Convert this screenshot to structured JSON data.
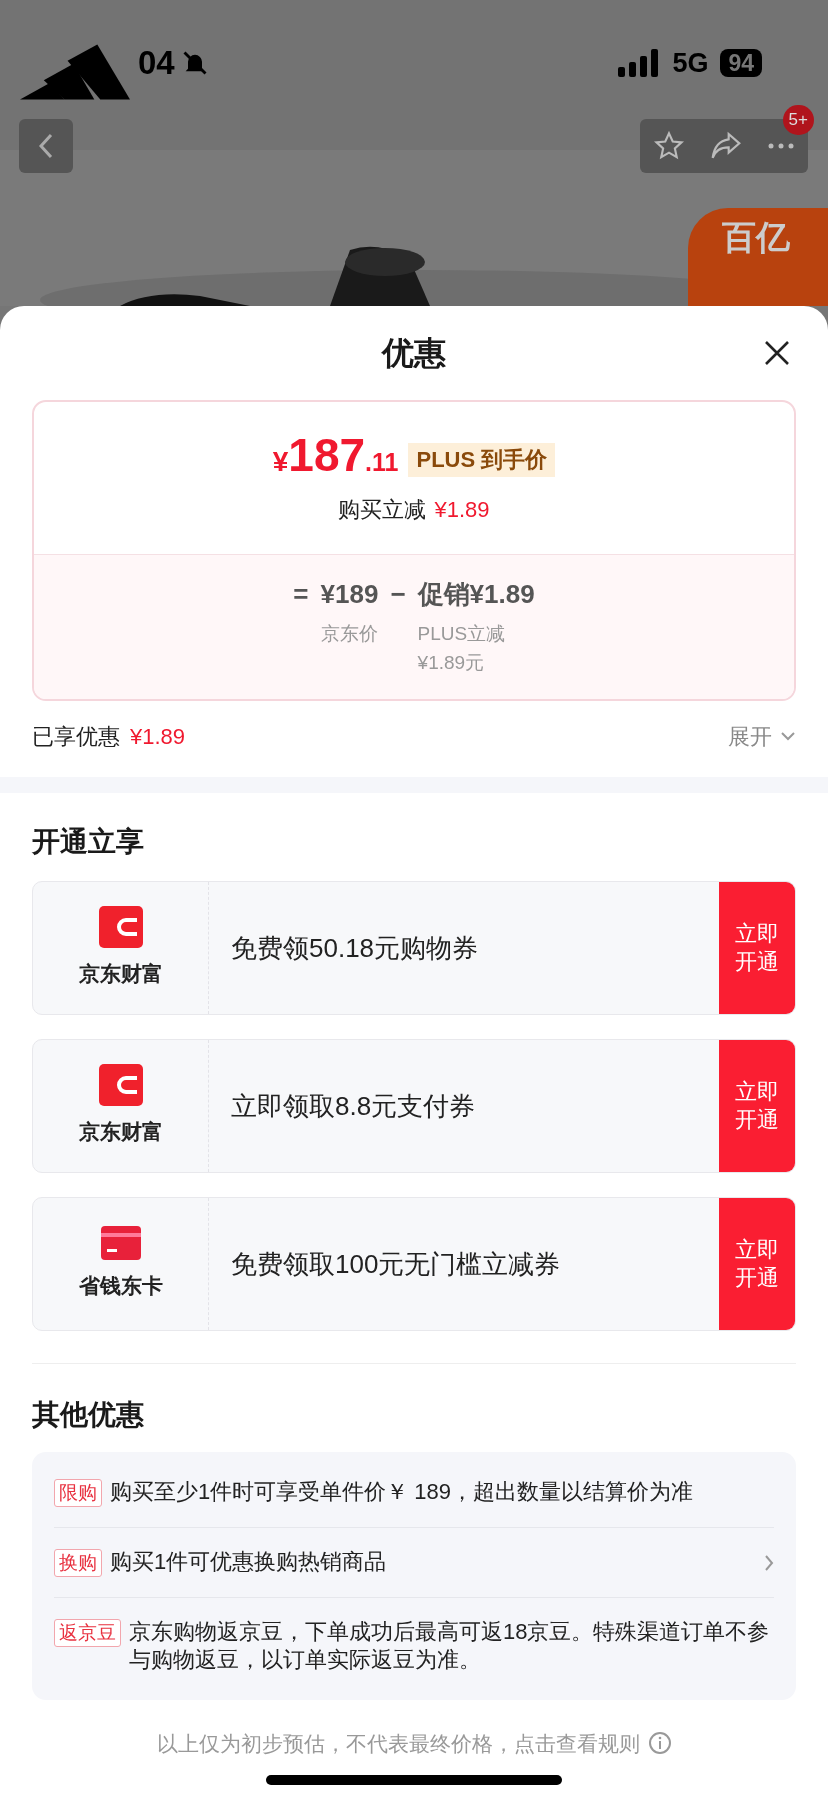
{
  "status_bar": {
    "time": "04",
    "network": "5G",
    "battery": "94"
  },
  "nav": {
    "badge": "5+"
  },
  "promo_badge": {
    "text": "百亿"
  },
  "sheet": {
    "title": "优惠"
  },
  "price_card": {
    "currency": "¥",
    "integer": "187",
    "decimal": ".11",
    "tag": "PLUS 到手价",
    "reduce_label": "购买立减",
    "reduce_amount": "¥1.89",
    "formula": {
      "equals": "=",
      "base": "¥189",
      "base_label": "京东价",
      "minus": "−",
      "promo": "促销¥1.89",
      "promo_label": "PLUS立减",
      "promo_note": "¥1.89元"
    }
  },
  "summary": {
    "label": "已享优惠",
    "amount": "¥1.89",
    "expand": "展开"
  },
  "open_section": {
    "title": "开通立享",
    "offers": [
      {
        "kind": "wallet",
        "brand": "京东财富",
        "text": "免费领50.18元购物券",
        "button": "立即开通"
      },
      {
        "kind": "wallet",
        "brand": "京东财富",
        "text": "立即领取8.8元支付券",
        "button": "立即开通"
      },
      {
        "kind": "card",
        "brand": "省钱东卡",
        "text": "免费领取100元无门槛立减券",
        "button": "立即开通"
      }
    ]
  },
  "other_section": {
    "title": "其他优惠",
    "items": [
      {
        "tag": "限购",
        "text": "购买至少1件时可享受单件价￥ 189，超出数量以结算价为准",
        "has_arrow": false
      },
      {
        "tag": "换购",
        "text": "购买1件可优惠换购热销商品",
        "has_arrow": true
      },
      {
        "tag": "返京豆",
        "text": "京东购物返京豆，下单成功后最高可返18京豆。特殊渠道订单不参与购物返豆，以订单实际返豆为准。",
        "has_arrow": false
      }
    ]
  },
  "footer": {
    "text": "以上仅为初步预估，不代表最终价格，点击查看规则"
  }
}
